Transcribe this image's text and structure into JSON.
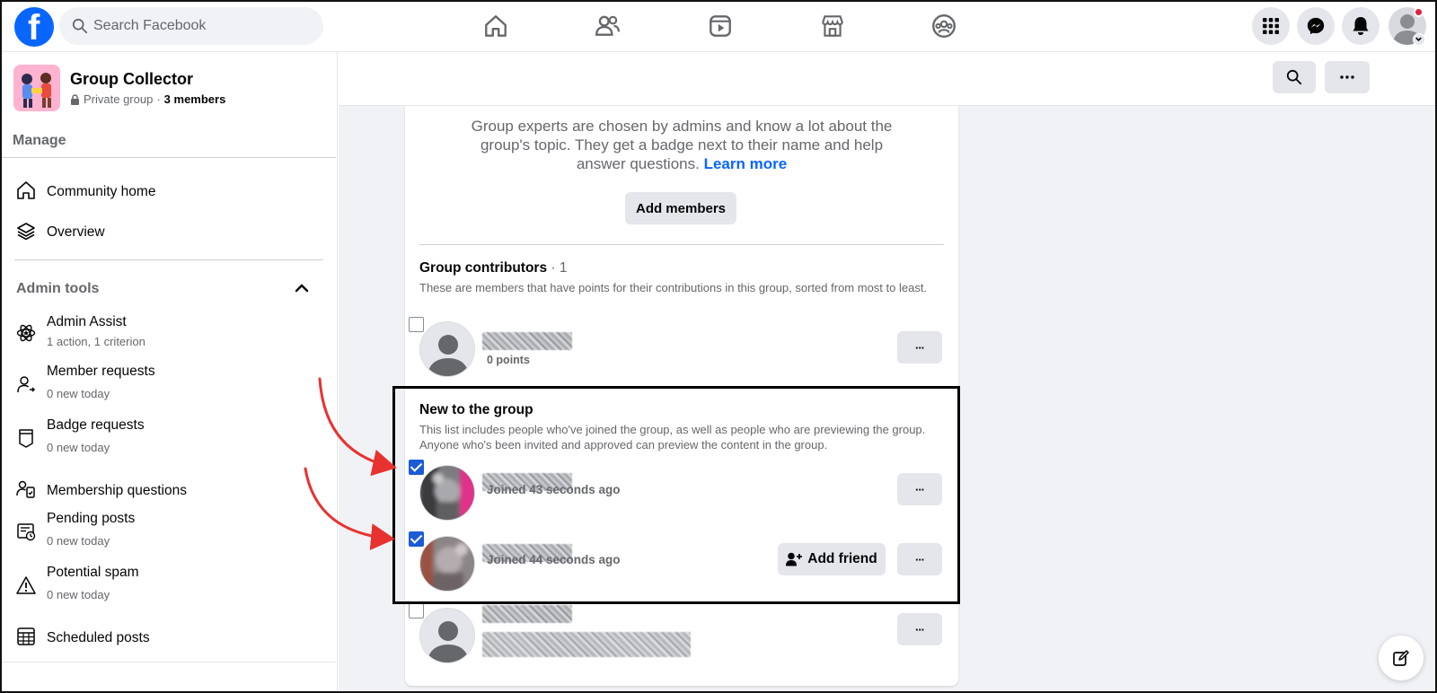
{
  "topbar": {
    "logo_letter": "f",
    "search_placeholder": "Search Facebook",
    "nav_icons": [
      "home-icon",
      "friends-icon",
      "video-icon",
      "marketplace-icon",
      "groups-icon"
    ],
    "right_icons": [
      "menu-grid-icon",
      "messenger-icon",
      "notifications-icon",
      "account-avatar"
    ],
    "brand_color": "#0866ff"
  },
  "group": {
    "name": "Group Collector",
    "privacy": "Private group",
    "separator": "·",
    "members": "3 members"
  },
  "sidebar": {
    "manage_label": "Manage",
    "items": [
      {
        "label": "Community home",
        "icon": "home-outline-icon"
      },
      {
        "label": "Overview",
        "icon": "layers-icon"
      }
    ],
    "admin_tools_label": "Admin tools",
    "admin_items": [
      {
        "label": "Admin Assist",
        "sub": "1 action, 1 criterion",
        "icon": "admin-assist-icon"
      },
      {
        "label": "Member requests",
        "sub": "0 new today",
        "icon": "member-request-icon"
      },
      {
        "label": "Badge requests",
        "sub": "0 new today",
        "icon": "badge-icon"
      },
      {
        "label": "Membership questions",
        "sub": "",
        "icon": "questions-icon"
      },
      {
        "label": "Pending posts",
        "sub": "0 new today",
        "icon": "pending-posts-icon"
      },
      {
        "label": "Potential spam",
        "sub": "0 new today",
        "icon": "warning-icon"
      },
      {
        "label": "Scheduled posts",
        "sub": "",
        "icon": "calendar-icon"
      }
    ]
  },
  "main": {
    "experts_text": "Group experts are chosen by admins and know a lot about the group's topic. They get a badge next to their name and help answer questions.",
    "learn_more": "Learn more",
    "add_members": "Add members",
    "contributors": {
      "title": "Group contributors",
      "count": "· 1",
      "description": "These are members that have points for their contributions in this group, sorted from most to least.",
      "members": [
        {
          "sub": "0 points",
          "checked": false
        }
      ]
    },
    "new_members": {
      "title": "New to the group",
      "description": "This list includes people who've joined the group, as well as people who are previewing the group. Anyone who's been invited and approved can preview the content in the group.",
      "members": [
        {
          "sub": "Joined 43 seconds ago",
          "checked": true
        },
        {
          "sub": "Joined 44 seconds ago",
          "checked": true,
          "action": "Add friend"
        },
        {
          "sub": "",
          "checked": false
        }
      ]
    },
    "more_glyph": "···"
  }
}
